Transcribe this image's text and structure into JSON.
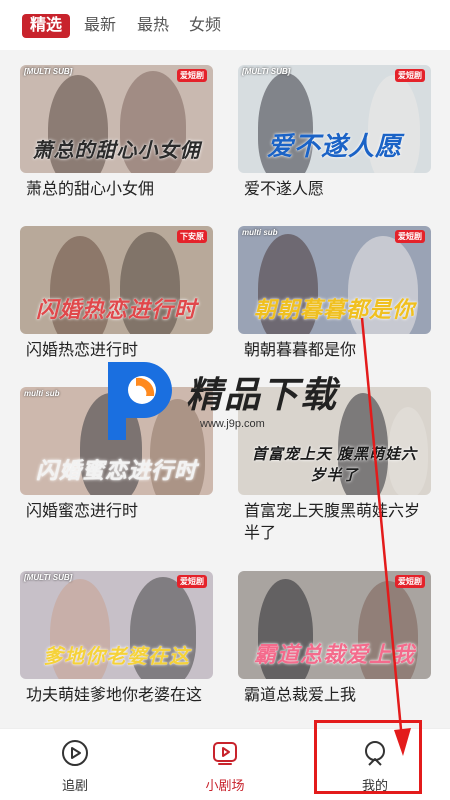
{
  "top_tabs": [
    {
      "label": "精选",
      "active": true
    },
    {
      "label": "最新",
      "active": false
    },
    {
      "label": "最热",
      "active": false
    },
    {
      "label": "女频",
      "active": false
    }
  ],
  "cards": [
    {
      "title": "萧总的甜心小女佣",
      "badge_left": "[MULTI SUB]",
      "badge_right": "爱短剧",
      "art": "萧总的甜心小女佣",
      "bg": "#c9b9b0",
      "art_color": "#2b2b2b"
    },
    {
      "title": "爱不遂人愿",
      "badge_left": "[MULTI SUB]",
      "badge_right": "爱短剧",
      "art": "爱不遂人愿",
      "bg": "#d7dde0",
      "art_color": "#1b63c6"
    },
    {
      "title": "闪婚热恋进行时",
      "badge_left": "",
      "badge_right": "下安原",
      "art": "闪婚热恋进行时",
      "bg": "#b8a99a",
      "art_color": "#e0484b"
    },
    {
      "title": "朝朝暮暮都是你",
      "badge_left": "multi sub",
      "badge_right": "爱短剧",
      "art": "朝朝暮暮都是你",
      "bg": "#9aa3b5",
      "art_color": "#f0c020"
    },
    {
      "title": "闪婚蜜恋进行时",
      "badge_left": "multi sub",
      "badge_right": "",
      "art": "闪婚蜜恋进行时",
      "bg": "#cdb8ad",
      "art_color": "#f2f2f2"
    },
    {
      "title": "首富宠上天腹黑萌娃六岁半了",
      "badge_left": "",
      "badge_right": "",
      "art": "首富宠上天 腹黑萌娃六岁半了",
      "bg": "#d9d4cd",
      "art_color": "#1b1b1b"
    },
    {
      "title": "功夫萌娃爹地你老婆在这",
      "badge_left": "[MULTI SUB]",
      "badge_right": "爱短剧",
      "art": "爹地你老婆在这",
      "bg": "#c7c0c8",
      "art_color": "#f5d23a"
    },
    {
      "title": "霸道总裁爱上我",
      "badge_left": "",
      "badge_right": "爱短剧",
      "art": "霸道总裁爱上我",
      "bg": "#a9a4a0",
      "art_color": "#f46b8c"
    }
  ],
  "watermark": {
    "text": "精品下载",
    "url": "www.j9p.com"
  },
  "bottom_nav": [
    {
      "label": "追剧",
      "icon": "play-circle-icon",
      "active": false
    },
    {
      "label": "小剧场",
      "icon": "play-square-icon",
      "active": true
    },
    {
      "label": "我的",
      "icon": "profile-icon",
      "active": false
    }
  ],
  "colors": {
    "accent": "#c8232c",
    "annotation": "#e31b1b"
  }
}
